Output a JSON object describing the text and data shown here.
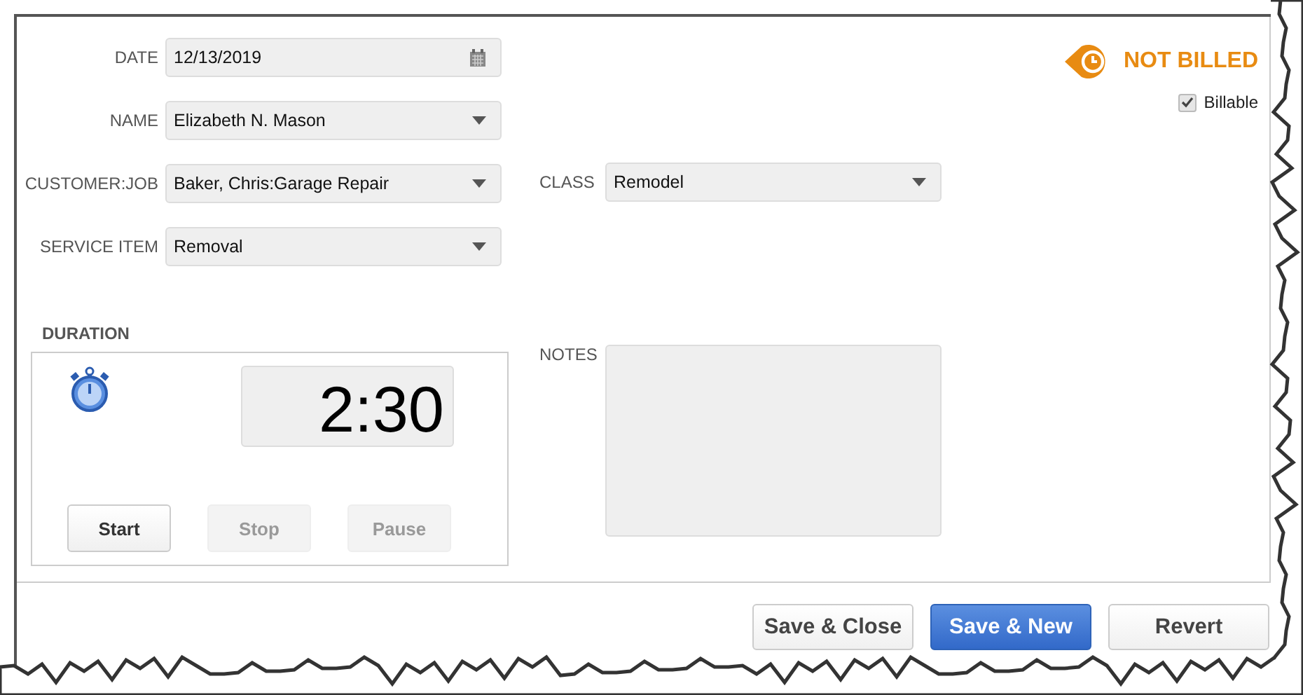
{
  "fields": [
    {
      "label": "DATE",
      "value": "12/13/2019",
      "kind": "date"
    },
    {
      "label": "NAME",
      "value": "Elizabeth N. Mason",
      "kind": "dropdown"
    },
    {
      "label": "CUSTOMER:JOB",
      "value": "Baker, Chris:Garage Repair",
      "kind": "dropdown"
    },
    {
      "label": "SERVICE ITEM",
      "value": "Removal",
      "kind": "dropdown"
    }
  ],
  "class_field": {
    "label": "CLASS",
    "value": "Remodel"
  },
  "status": {
    "text": "NOT BILLED"
  },
  "billable": {
    "label": "Billable",
    "checked": true,
    "disabled": true
  },
  "duration": {
    "label": "DURATION",
    "time": "2:30",
    "buttons": [
      {
        "label": "Start",
        "disabled": false
      },
      {
        "label": "Stop",
        "disabled": true
      },
      {
        "label": "Pause",
        "disabled": true
      }
    ]
  },
  "notes": {
    "label": "NOTES"
  },
  "footer_buttons": [
    {
      "label": "Save & Close",
      "primary": false
    },
    {
      "label": "Save & New",
      "primary": true
    },
    {
      "label": "Revert",
      "primary": false
    }
  ]
}
